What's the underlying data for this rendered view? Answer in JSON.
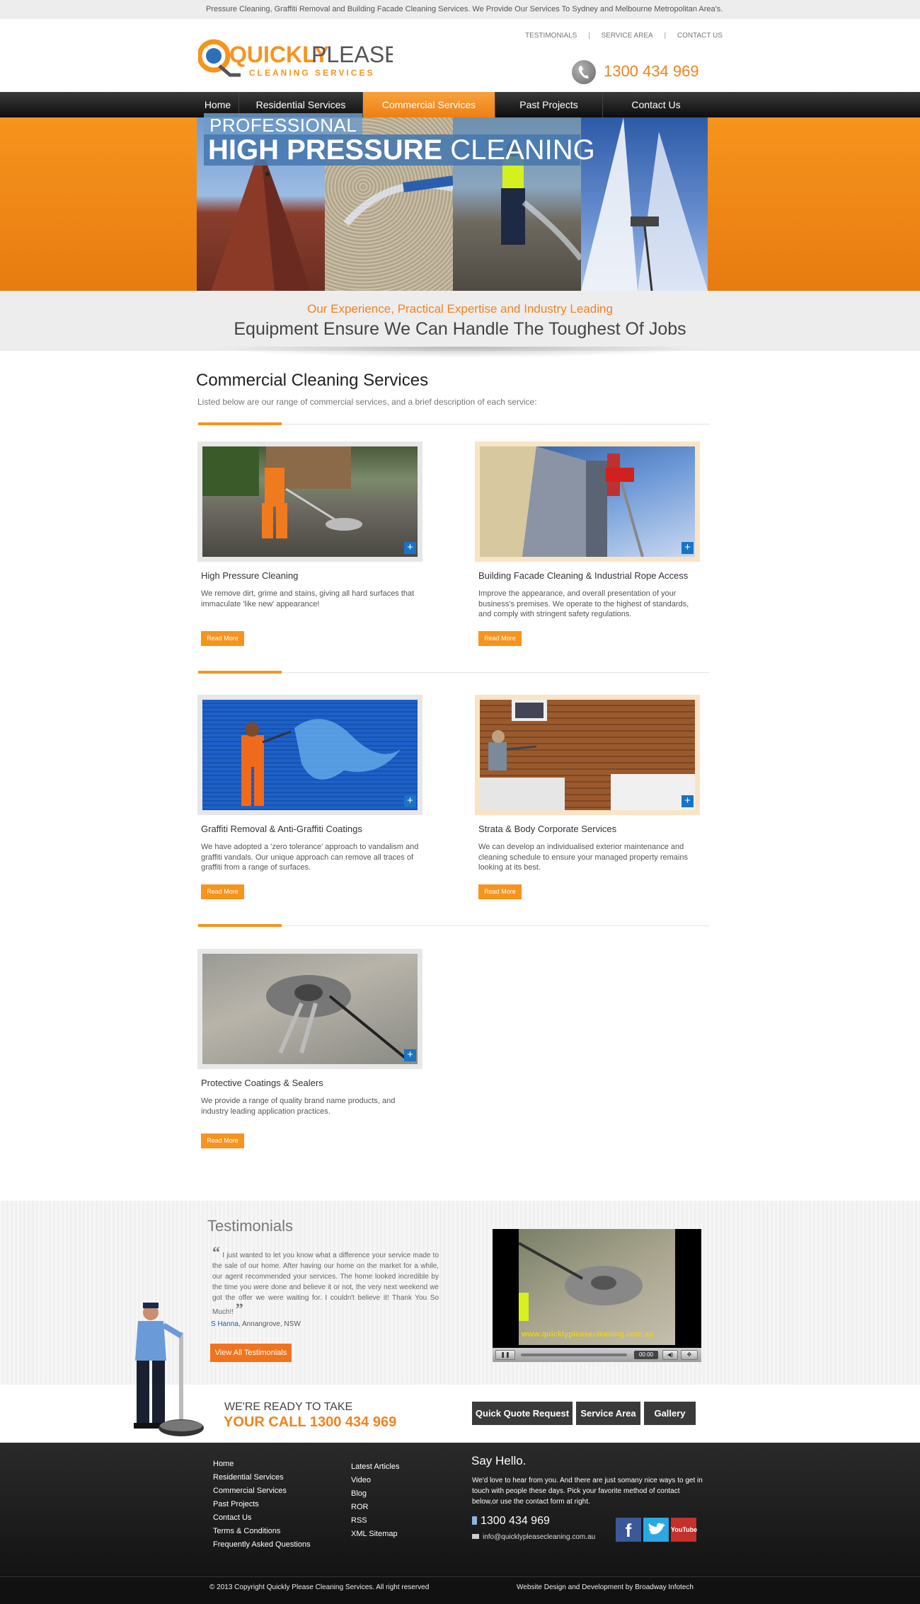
{
  "topbar": {
    "text": "Pressure Cleaning, Graffiti Removal and Building Facade Cleaning Services. We Provide Our Services To Sydney and Melbourne Metropolitan Area's."
  },
  "header": {
    "logo": {
      "word1": "QUICKLY",
      "word2": "PLEASE",
      "sub": "CLEANING SERVICES"
    },
    "toplinks": [
      "TESTIMONIALS",
      "SERVICE AREA",
      "CONTACT US"
    ],
    "toplink_sep": "|",
    "phone": "1300 434 969"
  },
  "nav": {
    "items": [
      "Home",
      "Residential Services",
      "Commercial Services",
      "Past Projects",
      "Contact Us"
    ],
    "active_index": 2
  },
  "hero": {
    "label_top": "PROFESSIONAL",
    "label_bold": "HIGH PRESSURE",
    "label_light": "CLEANING"
  },
  "tagline": {
    "line1": "Our Experience, Practical Expertise and Industry Leading",
    "line2": "Equipment Ensure We Can Handle The Toughest Of Jobs"
  },
  "section": {
    "title": "Commercial Cleaning Services",
    "subtitle": "Listed below are our range of commercial services, and a brief description of each service:"
  },
  "services": [
    {
      "title": "High Pressure Cleaning",
      "desc": "We remove dirt, grime and stains, giving all hard surfaces that immaculate 'like new' appearance!",
      "button": "Read More"
    },
    {
      "title": "Building Facade Cleaning & Industrial Rope Access",
      "desc": "Improve the appearance, and overall presentation of your business's premises. We operate to the highest of standards, and comply with stringent safety regulations.",
      "button": "Read More"
    },
    {
      "title": "Graffiti Removal & Anti-Graffiti Coatings",
      "desc": "We have adopted a 'zero tolerance' approach to vandalism and graffiti vandals. Our unique approach can remove all traces of graffiti from a range of surfaces.",
      "button": "Read More"
    },
    {
      "title": "Strata & Body Corporate Services",
      "desc": "We can develop an individualised exterior maintenance and cleaning schedule to ensure your managed property remains looking at its best.",
      "button": "Read More"
    },
    {
      "title": "Protective Coatings & Sealers",
      "desc": "We provide a range of quality brand name products, and industry leading application practices.",
      "button": "Read More"
    }
  ],
  "testimonials": {
    "title": "Testimonials",
    "quote": "I just wanted to let you know what a difference your service made to the sale of our home. After having our home on the market for a while, our agent recommended your services. The home looked incredible by the time you were done and believe it or not, the very next weekend we got the offer we were waiting for. I couldn't believe it! Thank You So Much!!",
    "author_name": "S Hanna,",
    "author_place": "Annangrove, NSW",
    "button": "View All Testimonials",
    "video_caption": "www.quicklypleasecleaning.com.au",
    "video_time": "00:00"
  },
  "call": {
    "line1": "WE'RE READY TO TAKE",
    "line2": "YOUR CALL 1300 434 969",
    "buttons": [
      "Quick Quote Request",
      "Service Area",
      "Gallery"
    ]
  },
  "footer": {
    "col1": [
      "Home",
      "Residential Services",
      "Commercial Services",
      "Past Projects",
      "Contact Us",
      "Terms & Conditions",
      "Frequently Asked Questions"
    ],
    "col2": [
      "Latest Articles",
      "Video",
      "Blog",
      "ROR",
      "RSS",
      "XML Sitemap"
    ],
    "say_title": "Say Hello.",
    "say_text": "We'd love to hear from you. And there are just somany nice ways to get in touch with people these days. Pick your favorite method of contact below,or use the contact form at right.",
    "phone": "1300 434 969",
    "email": "info@quicklypleasecleaning.com.au",
    "social": {
      "facebook": "f",
      "youtube": "YouTube"
    },
    "copyright": "© 2013 Copyright  Quickly Please Cleaning Services. All right reserved",
    "credit": "Website Design and Development by Broadway Infotech"
  },
  "colors": {
    "accent": "#f7941d",
    "nav_bg": "#1a1a1a",
    "footer_bg": "#1e1e1e",
    "link_blue": "#1a73c4"
  }
}
